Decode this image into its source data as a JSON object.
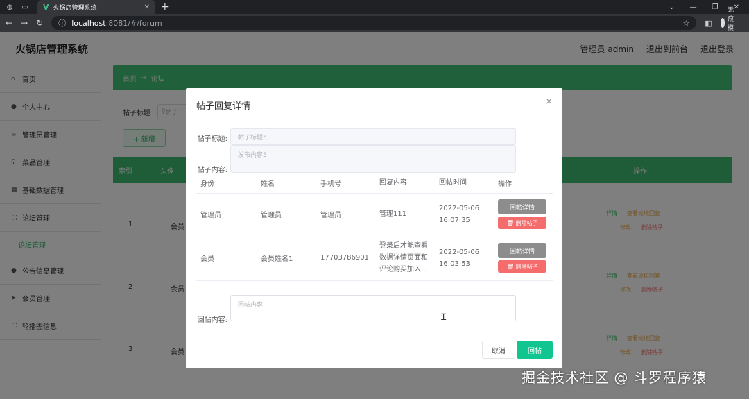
{
  "browser": {
    "tab_title": "火锅店管理系统",
    "url_host": "localhost",
    "url_path": ":8081/#/forum",
    "incognito_label": "无痕模式"
  },
  "app": {
    "title": "火锅店管理系统",
    "header_links": [
      "管理员 admin",
      "退出到前台",
      "退出登录"
    ]
  },
  "sidebar": {
    "items": [
      {
        "label": "首页",
        "icon": "home-icon"
      },
      {
        "label": "个人中心",
        "icon": "user-icon"
      },
      {
        "label": "管理员管理",
        "icon": "menu-icon"
      },
      {
        "label": "菜品管理",
        "icon": "pin-icon"
      },
      {
        "label": "基础数据管理",
        "icon": "grid-icon"
      },
      {
        "label": "论坛管理",
        "icon": "frame-icon"
      }
    ],
    "sub_item": "论坛管理",
    "items_after": [
      {
        "label": "公告信息管理",
        "icon": "user-icon"
      },
      {
        "label": "会员管理",
        "icon": "send-icon"
      },
      {
        "label": "轮播图信息",
        "icon": "frame-icon"
      }
    ]
  },
  "main": {
    "breadcrumb": [
      "首页",
      "论坛"
    ],
    "search_label": "帖子标题",
    "search_placeholder": "帖子",
    "add_button": "+ 新增",
    "table_head": [
      "索引",
      "头像",
      "操作"
    ],
    "rows": [
      {
        "index": "1",
        "who": "会员"
      },
      {
        "index": "2",
        "who": "会员"
      },
      {
        "index": "3",
        "who": "会员"
      }
    ],
    "row_actions": {
      "detail": "详情",
      "view_replies": "查看论坛回复",
      "edit": "修改",
      "delete": "删除帖子"
    }
  },
  "dialog": {
    "title": "帖子回复详情",
    "close": "×",
    "title_label": "帖子标题:",
    "title_value": "帖子标题5",
    "content_label": "帖子内容:",
    "content_value": "发布内容5",
    "columns": [
      "身份",
      "姓名",
      "手机号",
      "回复内容",
      "回帖时间",
      "操作"
    ],
    "replies": [
      {
        "identity": "管理员",
        "name": "管理员",
        "phone": "管理员",
        "content": "管理111",
        "time": "2022-05-06 16:07:35"
      },
      {
        "identity": "会员",
        "name": "会员姓名1",
        "phone": "17703786901",
        "content": "登录后才能查看数据详情页面和评论购买加入...",
        "time": "2022-05-06 16:03:53"
      }
    ],
    "detail_button": "回帖详情",
    "delete_button": "删除帖子",
    "reply_label": "回帖内容:",
    "reply_placeholder": "回帖内容",
    "cancel_button": "取消",
    "submit_button": "回帖"
  },
  "watermark": "掘金技术社区 @ 斗罗程序猿",
  "colors": {
    "accent_green": "#41c074",
    "submit_green": "#10c58f",
    "danger": "#f56c6c"
  }
}
